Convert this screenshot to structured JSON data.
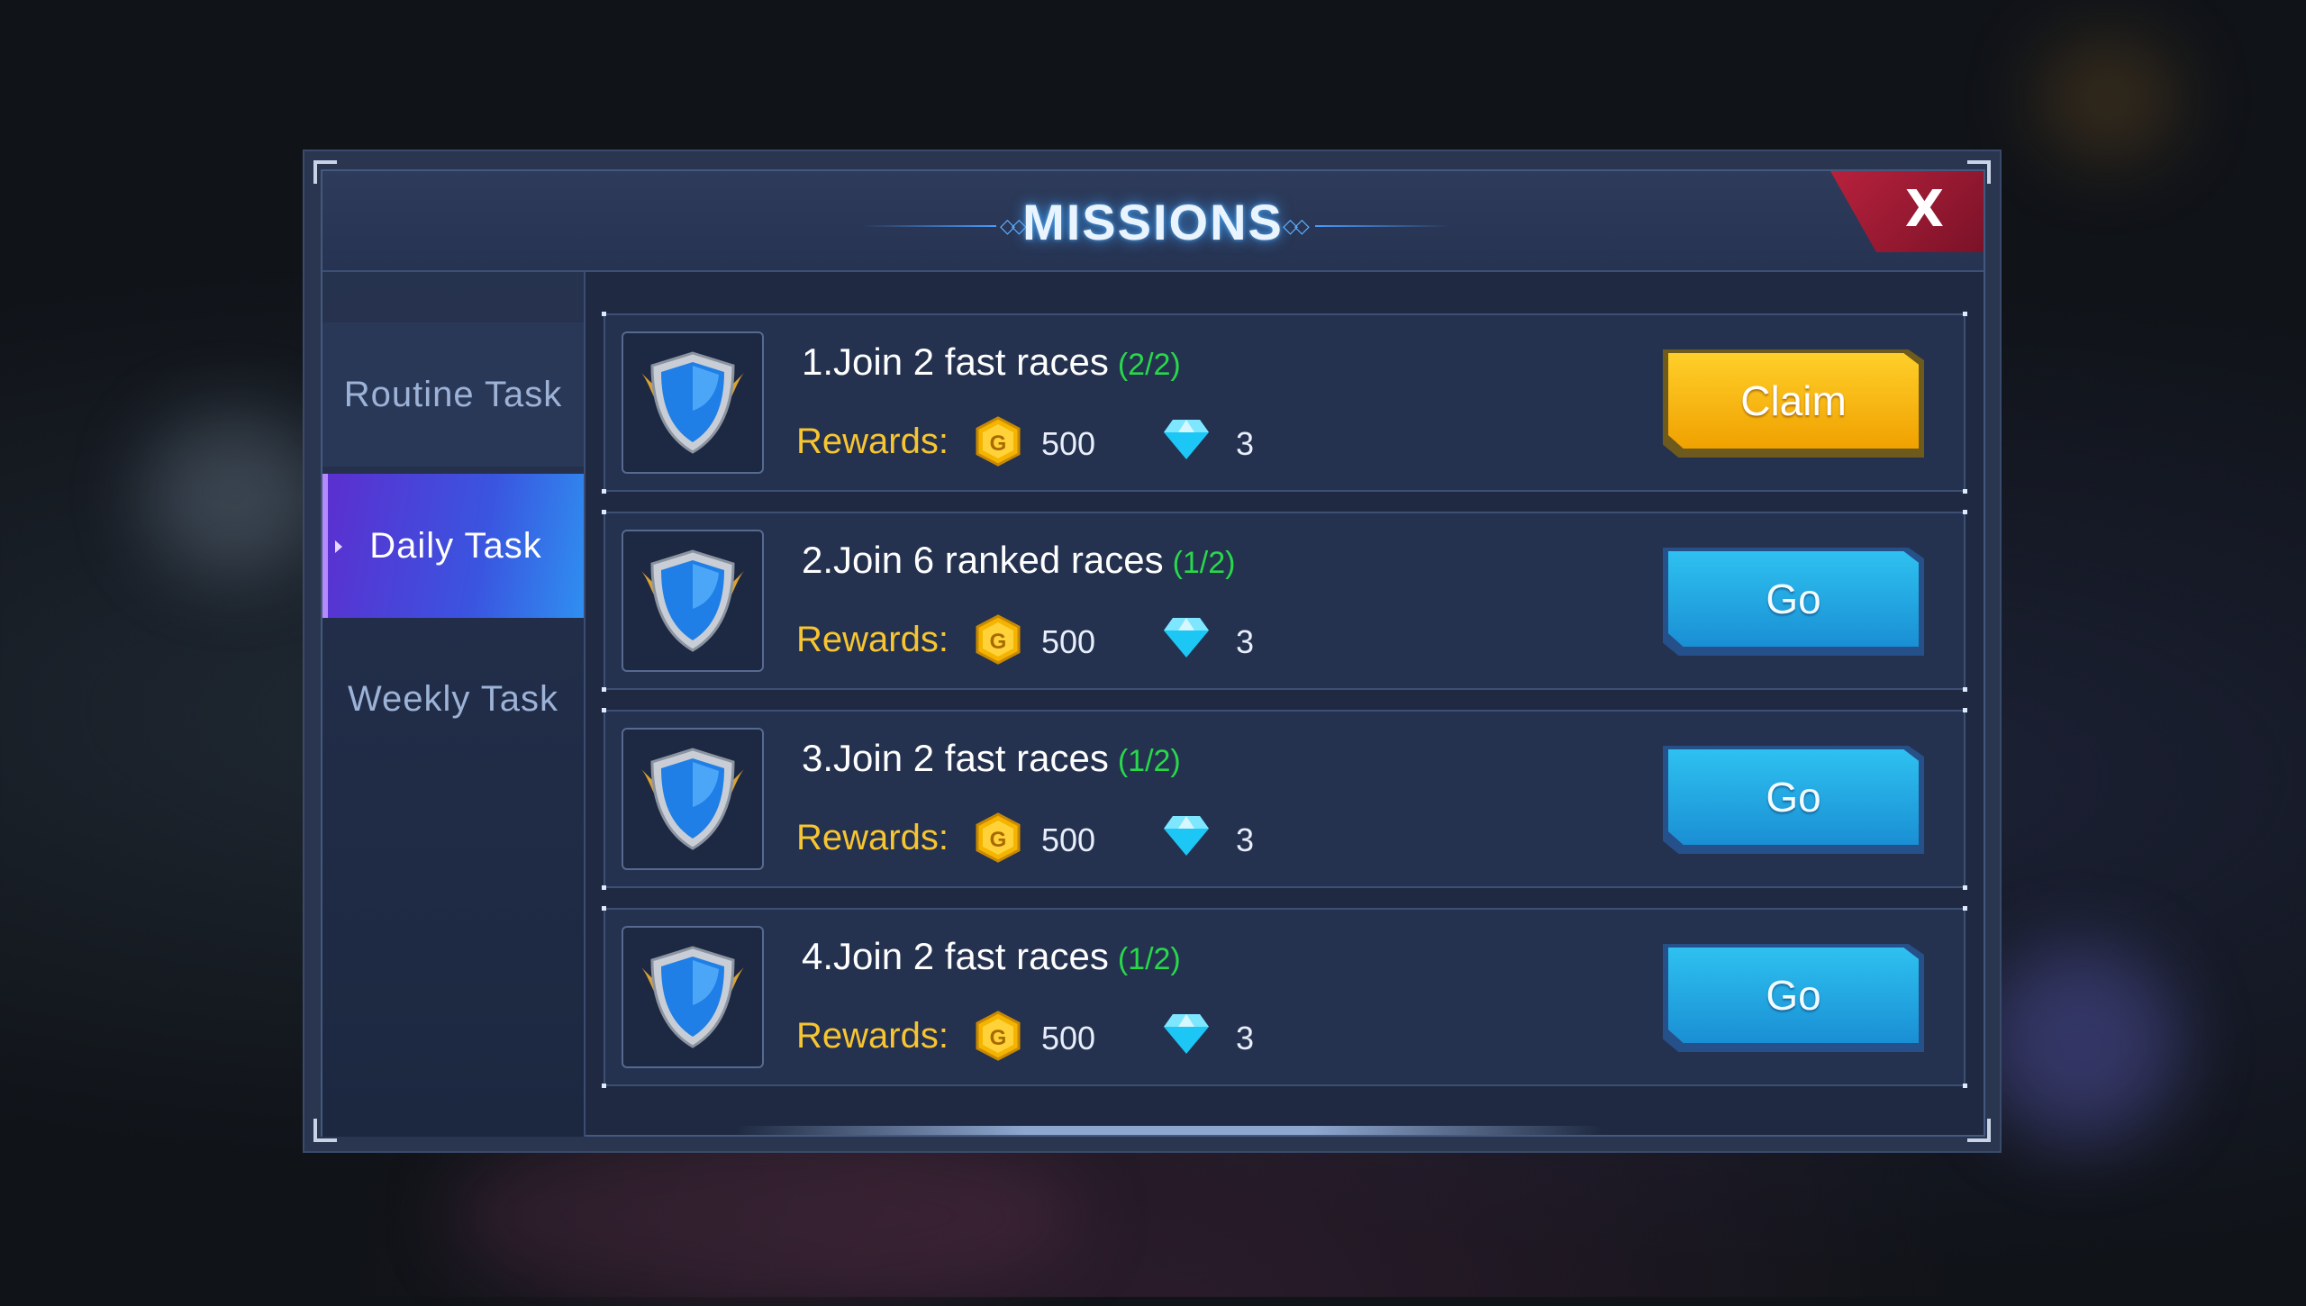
{
  "header": {
    "title": "MISSIONS",
    "close_label": "X"
  },
  "sidebar": {
    "tabs": [
      {
        "label": "Routine Task",
        "active": false
      },
      {
        "label": "Daily Task",
        "active": true
      },
      {
        "label": "Weekly Task",
        "active": false
      }
    ]
  },
  "missions": [
    {
      "task": "1.Join 2 fast races",
      "progress": "(2/2)",
      "rewards_label": "Rewards:",
      "coin_symbol": "G",
      "coins": "500",
      "gems": "3",
      "button": "Claim",
      "button_style": "claim"
    },
    {
      "task": "2.Join 6 ranked races",
      "progress": "(1/2)",
      "rewards_label": "Rewards:",
      "coin_symbol": "G",
      "coins": "500",
      "gems": "3",
      "button": "Go",
      "button_style": "go"
    },
    {
      "task": "3.Join 2 fast races",
      "progress": "(1/2)",
      "rewards_label": "Rewards:",
      "coin_symbol": "G",
      "coins": "500",
      "gems": "3",
      "button": "Go",
      "button_style": "go"
    },
    {
      "task": "4.Join 2 fast races",
      "progress": "(1/2)",
      "rewards_label": "Rewards:",
      "coin_symbol": "G",
      "coins": "500",
      "gems": "3",
      "button": "Go",
      "button_style": "go"
    }
  ],
  "colors": {
    "accent": "#2ec1f0",
    "claim": "#f0a100",
    "progress": "#29d84a",
    "rewards": "#f7c531",
    "close": "#b8213c"
  },
  "icons": {
    "mission": "winged-shield-icon",
    "coin": "gold-coin-icon",
    "gem": "diamond-icon",
    "close": "close-icon"
  }
}
